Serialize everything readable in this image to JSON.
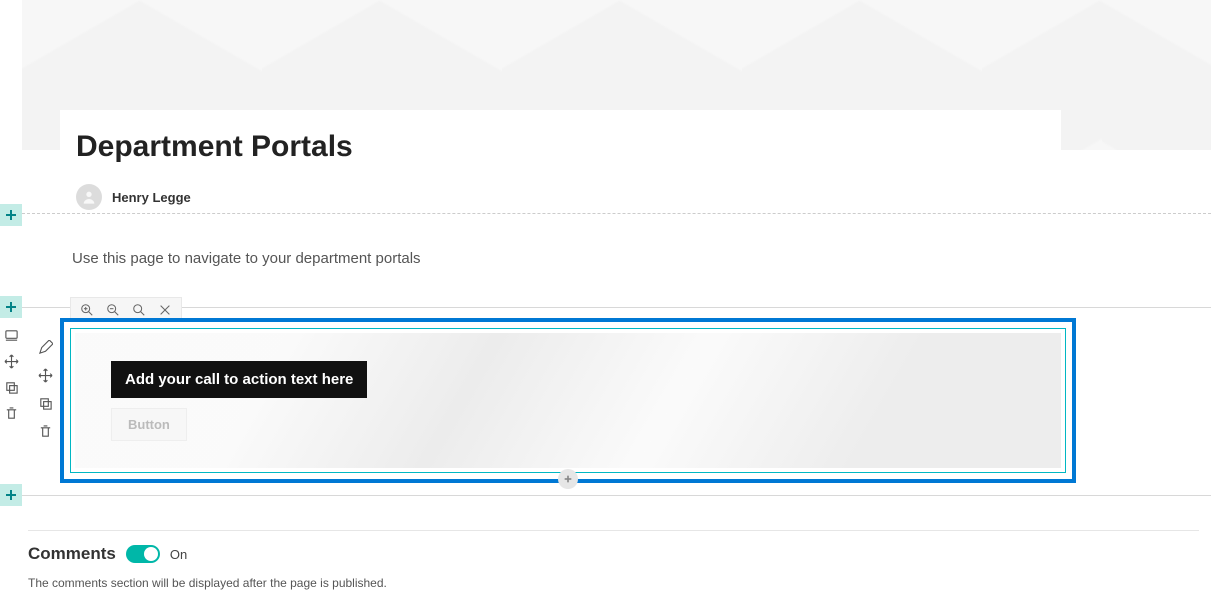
{
  "page": {
    "title": "Department Portals",
    "author": "Henry Legge",
    "description": "Use this page to navigate to your department portals"
  },
  "cta": {
    "text": "Add your call to action text here",
    "button_label": "Button"
  },
  "image_toolbar": {
    "zoom_in": "zoom-in",
    "zoom_out": "zoom-out",
    "reset": "reset-zoom",
    "close": "close"
  },
  "comments": {
    "label": "Comments",
    "state": "On",
    "note": "The comments section will be displayed after the page is published."
  }
}
